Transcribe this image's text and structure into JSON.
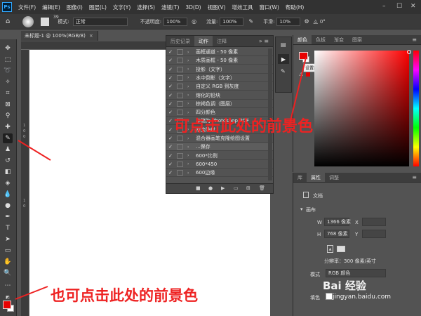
{
  "app": {
    "logo": "Ps"
  },
  "menu": [
    "文件(F)",
    "编辑(E)",
    "图像(I)",
    "图层(L)",
    "文字(Y)",
    "选择(S)",
    "滤镜(T)",
    "3D(D)",
    "视图(V)",
    "增效工具",
    "窗口(W)",
    "帮助(H)"
  ],
  "options": {
    "brush_size": "39",
    "mode_label": "模式:",
    "mode_value": "正常",
    "opacity_label": "不透明度:",
    "opacity_value": "100%",
    "flow_label": "流量:",
    "flow_value": "100%",
    "smooth_label": "平滑:",
    "smooth_value": "10%",
    "angle_value": "0°"
  },
  "document": {
    "tab_title": "未标题-1 @ 100%(RGB/8)",
    "close": "×"
  },
  "ruler_left_nums": [
    "1",
    "0",
    "0",
    "1",
    "0"
  ],
  "actions_panel": {
    "tabs": [
      "历史记录",
      "动作",
      "注释"
    ],
    "rows": [
      "画框通道 - 50 像素",
      "木质画框 - 50 像素",
      "投影（文字）",
      "水中倒影（文字）",
      "自定义 RGB 到灰度",
      "熔化的铅块",
      "棕褐色调（图层）",
      "四分颜色",
      "存储为 Photoshop PDF",
      "渐变映射",
      "混合器画笔克隆绘图设置",
      "...保存",
      "600*比例",
      "600*450",
      "600边缘"
    ]
  },
  "color_panel": {
    "tabs": [
      "颜色",
      "色板",
      "渐变",
      "图案"
    ],
    "tooltip": "设置前景色"
  },
  "properties_panel": {
    "tabs": [
      "库",
      "属性",
      "调整"
    ],
    "doc_label": "文档",
    "canvas_label": "画布",
    "w_label": "W",
    "w_value": "1366 像素",
    "x_label": "X",
    "h_label": "H",
    "h_value": "768 像素",
    "y_label": "Y",
    "resolution": "分辨率：300 像素/英寸",
    "mode_label": "模式",
    "mode_value": "RGB 颜色",
    "fill_label": "填色"
  },
  "annotations": {
    "top": "可点击此处的前景色",
    "bottom": "也可点击此处的前景色"
  },
  "watermark": {
    "main": "Bai 经验",
    "sub": "jingyan.baidu.com"
  },
  "colors": {
    "foreground": "#e60000",
    "background": "#ffffff",
    "annotation": "#ee2222"
  }
}
